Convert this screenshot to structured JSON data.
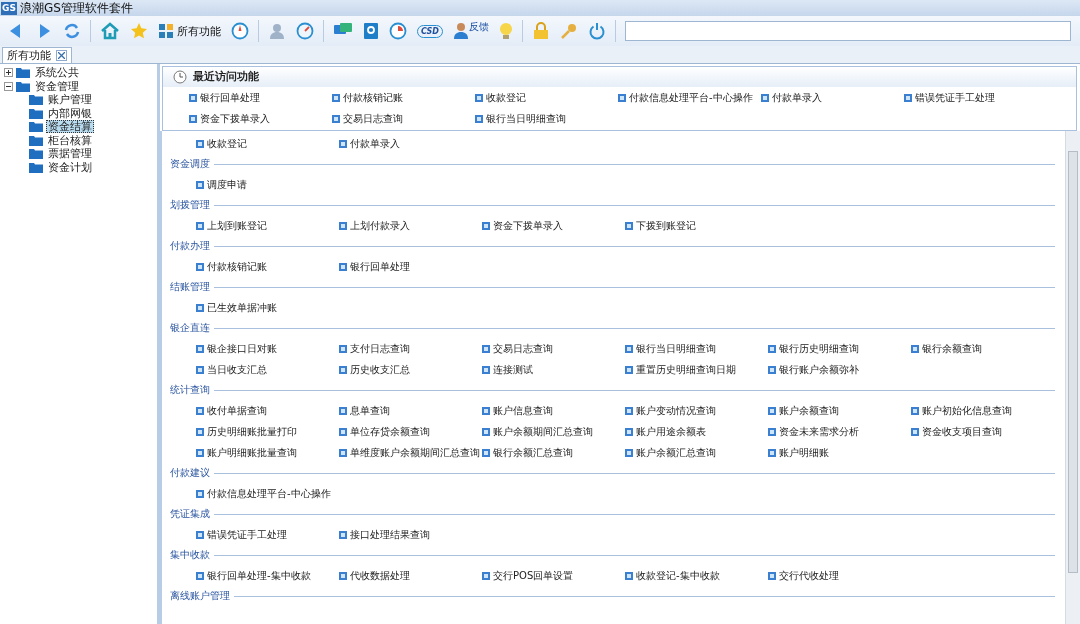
{
  "window": {
    "title": "浪潮GS管理软件套件",
    "app_badge": "GS"
  },
  "toolbar": [
    {
      "kind": "back"
    },
    {
      "kind": "forward"
    },
    {
      "kind": "refresh"
    },
    {
      "kind": "sep"
    },
    {
      "kind": "home"
    },
    {
      "kind": "star"
    },
    {
      "kind": "grid",
      "label": "所有功能"
    },
    {
      "kind": "compass"
    },
    {
      "kind": "sep"
    },
    {
      "kind": "user"
    },
    {
      "kind": "gauge"
    },
    {
      "kind": "sep"
    },
    {
      "kind": "chat"
    },
    {
      "kind": "help"
    },
    {
      "kind": "pie"
    },
    {
      "kind": "cloud",
      "label": "CSD"
    },
    {
      "kind": "person",
      "label": "反馈"
    },
    {
      "kind": "bulb"
    },
    {
      "kind": "sep"
    },
    {
      "kind": "lock"
    },
    {
      "kind": "key"
    },
    {
      "kind": "power"
    },
    {
      "kind": "sep"
    }
  ],
  "tabs": [
    {
      "label": "所有功能",
      "selected": true
    }
  ],
  "tree": [
    {
      "label": "系统公共",
      "expanded": false,
      "selected": false
    },
    {
      "label": "资金管理",
      "expanded": true,
      "selected": false,
      "children": [
        {
          "label": "账户管理",
          "selected": false
        },
        {
          "label": "内部网银",
          "selected": false
        },
        {
          "label": "资金结算",
          "selected": true
        },
        {
          "label": "柜台核算",
          "selected": false
        },
        {
          "label": "票据管理",
          "selected": false
        },
        {
          "label": "资金计划",
          "selected": false
        }
      ]
    }
  ],
  "recent": {
    "title": "最近访问功能",
    "items": [
      "银行回单处理",
      "付款核销记账",
      "收款登记",
      "付款信息处理平台-中心操作",
      "付款单录入",
      "错误凭证手工处理",
      "资金下拨单录入",
      "交易日志查询",
      "银行当日明细查询"
    ]
  },
  "sections": [
    {
      "items": [
        "收款登记",
        "付款单录入"
      ]
    },
    {
      "title": "资金调度",
      "items": [
        "调度申请"
      ]
    },
    {
      "title": "划拨管理",
      "items": [
        "上划到账登记",
        "上划付款录入",
        "资金下拨单录入",
        "下拨到账登记"
      ]
    },
    {
      "title": "付款办理",
      "items": [
        "付款核销记账",
        "银行回单处理"
      ]
    },
    {
      "title": "结账管理",
      "items": [
        "已生效单据冲账"
      ]
    },
    {
      "title": "银企直连",
      "items": [
        "银企接口日对账",
        "支付日志查询",
        "交易日志查询",
        "银行当日明细查询",
        "银行历史明细查询",
        "银行余额查询",
        "当日收支汇总",
        "历史收支汇总",
        "连接测试",
        "重置历史明细查询日期",
        "银行账户余额弥补"
      ]
    },
    {
      "title": "统计查询",
      "items": [
        "收付单据查询",
        "息单查询",
        "账户信息查询",
        "账户变动情况查询",
        "账户余额查询",
        "账户初始化信息查询",
        "历史明细账批量打印",
        "单位存贷余额查询",
        "账户余额期间汇总查询",
        "账户用途余额表",
        "资金未来需求分析",
        "资金收支项目查询",
        "账户明细账批量查询",
        "单维度账户余额期间汇总查询",
        "银行余额汇总查询",
        "账户余额汇总查询",
        "账户明细账"
      ]
    },
    {
      "title": "付款建议",
      "items": [
        "付款信息处理平台-中心操作"
      ]
    },
    {
      "title": "凭证集成",
      "items": [
        "错误凭证手工处理",
        "接口处理结果查询"
      ]
    },
    {
      "title": "集中收款",
      "items": [
        "银行回单处理-集中收款",
        "代收数据处理",
        "交行POS回单设置",
        "收款登记-集中收款",
        "交行代收处理"
      ]
    },
    {
      "title": "离线账户管理"
    }
  ]
}
